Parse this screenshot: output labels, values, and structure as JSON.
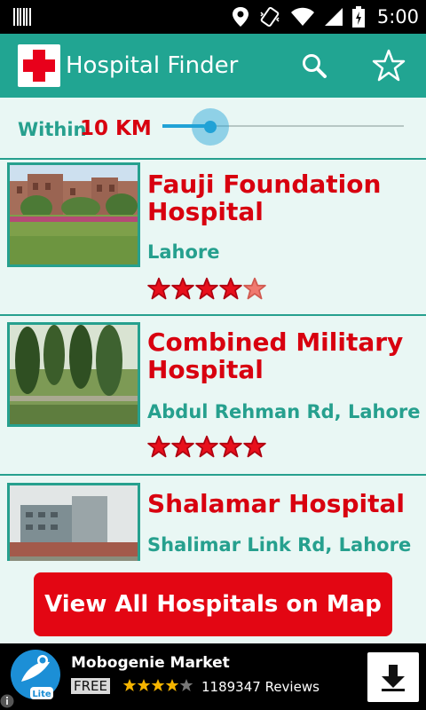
{
  "status_bar": {
    "time": "5:00",
    "icons": [
      "barcode-icon",
      "location-icon",
      "vibrate-icon",
      "wifi-icon",
      "cell-signal-icon",
      "battery-icon"
    ]
  },
  "app_bar": {
    "title": "Hospital Finder",
    "icons": [
      "red-cross-logo-icon",
      "search-icon",
      "star-icon"
    ],
    "color": "#21a592"
  },
  "distance_filter": {
    "label": "Within",
    "value": "10 KM",
    "slider_fraction": 0.2
  },
  "hospitals": [
    {
      "name_line1": "Fauji Foundation",
      "name_line2": "Hospital",
      "address": "Lahore",
      "rating": 4.5,
      "max_rating": 5
    },
    {
      "name_line1": "Combined Military",
      "name_line2": "Hospital",
      "address": "Abdul Rehman Rd, Lahore",
      "rating": 5,
      "max_rating": 5
    },
    {
      "name_line1": "Shalamar Hospital",
      "name_line2": "",
      "address": "Shalimar Link Rd, Lahore",
      "rating": null,
      "max_rating": 5
    }
  ],
  "map_button": {
    "label": "View All Hospitals on Map",
    "color": "#e30613"
  },
  "ad": {
    "title": "Mobogenie Market",
    "badge": "FREE",
    "logo_text": "Lite",
    "rating": 4,
    "max_rating": 5,
    "reviews": "1189347 Reviews",
    "icons": [
      "mobogenie-logo-icon",
      "download-arrow-icon",
      "info-icon"
    ]
  },
  "colors": {
    "accent_teal": "#26a08e",
    "accent_red": "#d8000f",
    "background": "#e9f7f4"
  }
}
